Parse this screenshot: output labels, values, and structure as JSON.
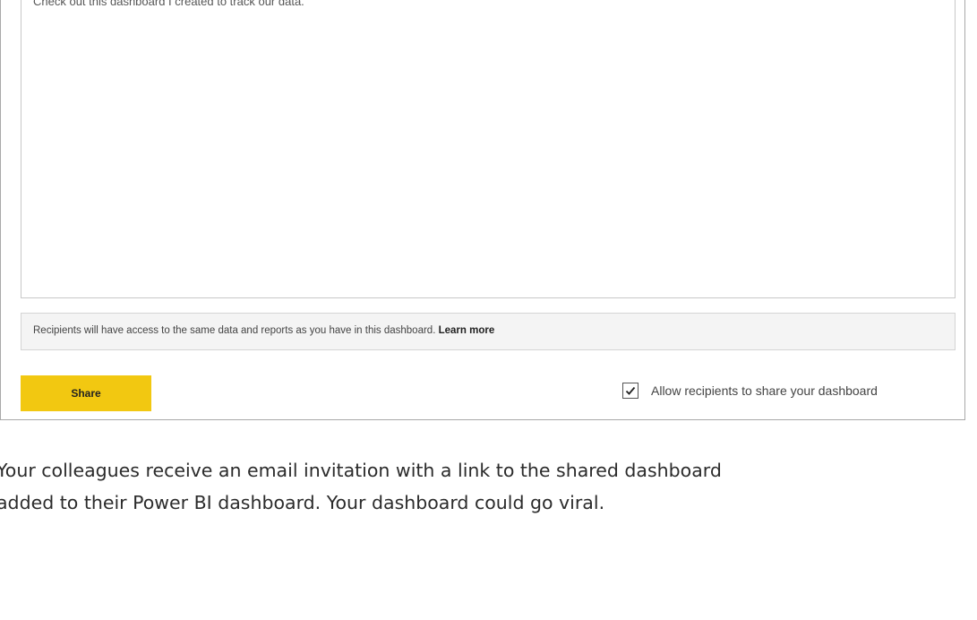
{
  "dialog": {
    "message_text": "Check out this dashboard I created to track our data.",
    "info_text": "Recipients will have access to the same data and reports as you have in this dashboard.",
    "learn_more_label": "Learn more",
    "share_label": "Share",
    "allow_label": "Allow recipients to share your dashboard",
    "allow_checked": true,
    "share_button_color": "#f2c811"
  },
  "caption": {
    "line1": "Your colleagues receive an email invitation with a link to the shared dashboard",
    "line2": "added to their Power BI dashboard. Your dashboard could go viral."
  }
}
